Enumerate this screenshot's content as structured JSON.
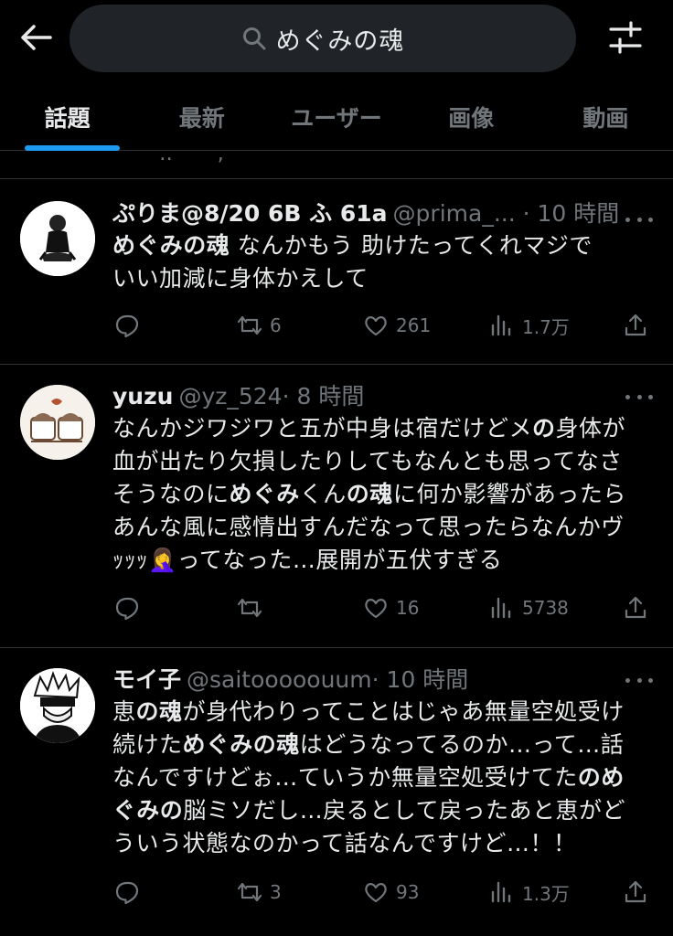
{
  "search": {
    "query": "めぐみの魂"
  },
  "tabs": [
    {
      "label": "話題"
    },
    {
      "label": "最新"
    },
    {
      "label": "ユーザー"
    },
    {
      "label": "画像"
    },
    {
      "label": "動画"
    }
  ],
  "stub_text": "' ' ‥ ˘ ,",
  "tweets": [
    {
      "name": "ぷりま@8/20 6B ふ 61a",
      "handle": "@prima_... ",
      "time": "· 10 時間",
      "lines": [
        [
          {
            "t": "めぐみの魂",
            "b": true
          },
          {
            "t": "  なんかもう  助けたってくれマジで"
          }
        ],
        [
          {
            "t": "いい加減に身体かえして"
          }
        ]
      ],
      "replies": "",
      "retweets": "6",
      "likes": "261",
      "views": "1.7万"
    },
    {
      "name": "yuzu",
      "handle": "@yz_524",
      "time": "· 8 時間",
      "lines": [
        [
          {
            "t": "なんかジワジワと五が中身は宿だけどメ"
          },
          {
            "t": "の",
            "b": true
          },
          {
            "t": "身体が"
          }
        ],
        [
          {
            "t": "血が出たり欠損したりしてもなんとも思ってなさ"
          }
        ],
        [
          {
            "t": "そうなのに"
          },
          {
            "t": "めぐみ",
            "b": true
          },
          {
            "t": "くん"
          },
          {
            "t": "の魂",
            "b": true
          },
          {
            "t": "に何か影響があったら"
          }
        ],
        [
          {
            "t": "あんな風に感情出すんだなって思ったらなんかヴ"
          }
        ],
        [
          {
            "t": "ｯｯｯ🤦‍♀️ってなった…展開が五伏すぎる"
          }
        ]
      ],
      "replies": "",
      "retweets": "",
      "likes": "16",
      "views": "5738"
    },
    {
      "name": "モイ子",
      "handle": "@saitooooouum",
      "time": "· 10 時間",
      "lines": [
        [
          {
            "t": "恵"
          },
          {
            "t": "の魂",
            "b": true
          },
          {
            "t": "が身代わりってことはじゃあ無量空処受け"
          }
        ],
        [
          {
            "t": "続けた"
          },
          {
            "t": "めぐみの魂",
            "b": true
          },
          {
            "t": "はどうなってるのか…って…話"
          }
        ],
        [
          {
            "t": "なんですけどぉ…ていうか無量空処受けてた"
          },
          {
            "t": "のめ",
            "b": true
          }
        ],
        [
          {
            "t": "ぐみの",
            "b": true
          },
          {
            "t": "脳ミソだし…戻るとして戻ったあと恵がど"
          }
        ],
        [
          {
            "t": "ういう状態なのかって話なんですけど…！！"
          }
        ]
      ],
      "replies": "",
      "retweets": "3",
      "likes": "93",
      "views": "1.3万"
    }
  ]
}
